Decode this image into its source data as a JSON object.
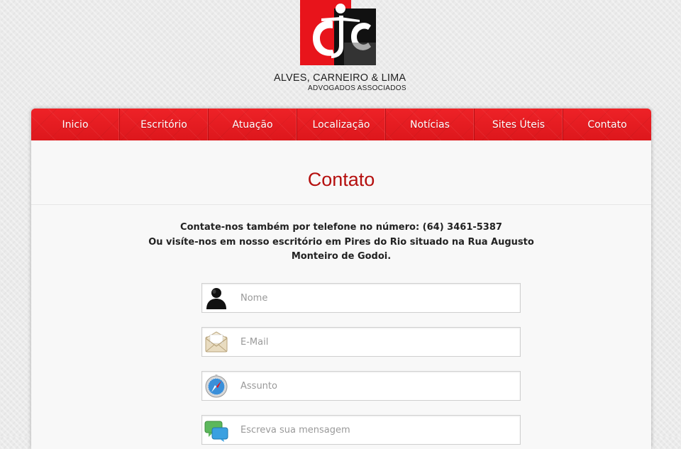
{
  "logo": {
    "name": "ALVES, CARNEIRO & LIMA",
    "subtitle": "ADVOGADOS ASSOCIADOS",
    "colors": {
      "red": "#e8141b",
      "black": "#111111"
    }
  },
  "nav": {
    "items": [
      {
        "label": "Inicio"
      },
      {
        "label": "Escritório"
      },
      {
        "label": "Atuação"
      },
      {
        "label": "Localização"
      },
      {
        "label": "Notícias"
      },
      {
        "label": "Sites Úteis"
      },
      {
        "label": "Contato"
      }
    ]
  },
  "page": {
    "title": "Contato",
    "intro_line1": "Contate-nos também por telefone no número: (64) 3461-5387",
    "intro_line2": "Ou visíte-nos em nosso escritório em Pires do Rio situado na Rua Augusto Monteiro de Godoi."
  },
  "form": {
    "name_placeholder": "Nome",
    "email_placeholder": "E-Mail",
    "subject_placeholder": "Assunto",
    "message_placeholder": "Escreva sua mensagem"
  },
  "icons": {
    "name": "user-icon",
    "email": "envelope-icon",
    "subject": "compass-icon",
    "message": "chat-bubbles-icon"
  },
  "colors": {
    "nav_red": "#e81a1f",
    "title_red": "#b5100f",
    "text": "#222222",
    "placeholder": "#999999"
  }
}
